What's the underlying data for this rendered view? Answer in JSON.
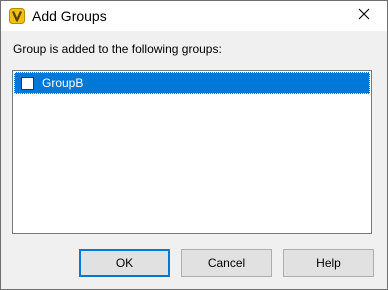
{
  "window": {
    "title": "Add Groups",
    "app_icon": "vault-app-icon",
    "close_icon": "close-icon",
    "accent_color": "#0078d7"
  },
  "instruction": "Group is added to the following groups:",
  "groups": [
    {
      "label": "GroupB",
      "checked": false,
      "selected": true
    }
  ],
  "buttons": {
    "ok": "OK",
    "cancel": "Cancel",
    "help": "Help"
  }
}
